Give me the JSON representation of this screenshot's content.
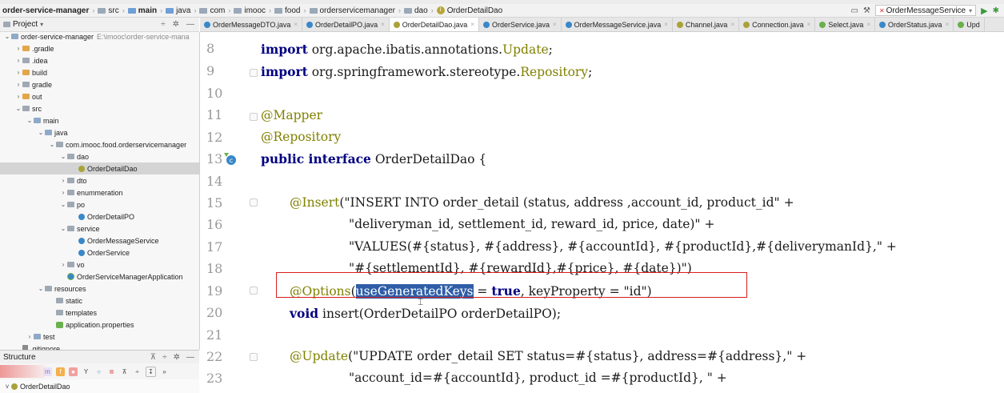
{
  "breadcrumb": [
    "order-service-manager",
    "src",
    "main",
    "java",
    "com",
    "imooc",
    "food",
    "orderservicemanager",
    "dao",
    "OrderDetailDao"
  ],
  "run_config": "OrderMessageService",
  "project_panel": {
    "title": "Project",
    "tree": [
      {
        "label": "order-service-manager",
        "hint": "E:\\imooc\\order-service-mana",
        "indent": 0,
        "arrow": "v",
        "icon": "module"
      },
      {
        "label": ".gradle",
        "indent": 1,
        "arrow": ">",
        "icon": "folder-orange"
      },
      {
        "label": ".idea",
        "indent": 1,
        "arrow": ">",
        "icon": "folder"
      },
      {
        "label": "build",
        "indent": 1,
        "arrow": ">",
        "icon": "folder-orange"
      },
      {
        "label": "gradle",
        "indent": 1,
        "arrow": ">",
        "icon": "folder"
      },
      {
        "label": "out",
        "indent": 1,
        "arrow": ">",
        "icon": "folder-orange"
      },
      {
        "label": "src",
        "indent": 1,
        "arrow": "v",
        "icon": "folder"
      },
      {
        "label": "main",
        "indent": 2,
        "arrow": "v",
        "icon": "folder-src"
      },
      {
        "label": "java",
        "indent": 3,
        "arrow": "v",
        "icon": "folder-src"
      },
      {
        "label": "com.imooc.food.orderservicemanager",
        "indent": 4,
        "arrow": "v",
        "icon": "folder"
      },
      {
        "label": "dao",
        "indent": 5,
        "arrow": "v",
        "icon": "folder"
      },
      {
        "label": "OrderDetailDao",
        "indent": 6,
        "arrow": "",
        "icon": "interface",
        "selected": true
      },
      {
        "label": "dto",
        "indent": 5,
        "arrow": ">",
        "icon": "folder"
      },
      {
        "label": "enummeration",
        "indent": 5,
        "arrow": ">",
        "icon": "folder"
      },
      {
        "label": "po",
        "indent": 5,
        "arrow": "v",
        "icon": "folder"
      },
      {
        "label": "OrderDetailPO",
        "indent": 6,
        "arrow": "",
        "icon": "class"
      },
      {
        "label": "service",
        "indent": 5,
        "arrow": "v",
        "icon": "folder"
      },
      {
        "label": "OrderMessageService",
        "indent": 6,
        "arrow": "",
        "icon": "class"
      },
      {
        "label": "OrderService",
        "indent": 6,
        "arrow": "",
        "icon": "class"
      },
      {
        "label": "vo",
        "indent": 5,
        "arrow": ">",
        "icon": "folder"
      },
      {
        "label": "OrderServiceManagerApplication",
        "indent": 5,
        "arrow": "",
        "icon": "app"
      },
      {
        "label": "resources",
        "indent": 3,
        "arrow": "v",
        "icon": "folder"
      },
      {
        "label": "static",
        "indent": 4,
        "arrow": "",
        "icon": "folder"
      },
      {
        "label": "templates",
        "indent": 4,
        "arrow": "",
        "icon": "folder"
      },
      {
        "label": "application.properties",
        "indent": 4,
        "arrow": "",
        "icon": "properties"
      },
      {
        "label": "test",
        "indent": 2,
        "arrow": ">",
        "icon": "folder-src"
      },
      {
        "label": ".gitignore",
        "indent": 1,
        "arrow": "",
        "icon": "file"
      }
    ]
  },
  "structure_panel": {
    "title": "Structure",
    "item": "OrderDetailDao"
  },
  "tabs": [
    {
      "label": "OrderMessageDTO.java",
      "icon": "class"
    },
    {
      "label": "OrderDetailPO.java",
      "icon": "class"
    },
    {
      "label": "OrderDetailDao.java",
      "icon": "interface",
      "active": true
    },
    {
      "label": "OrderService.java",
      "icon": "class"
    },
    {
      "label": "OrderMessageService.java",
      "icon": "class"
    },
    {
      "label": "Channel.java",
      "icon": "interface"
    },
    {
      "label": "Connection.java",
      "icon": "interface"
    },
    {
      "label": "Select.java",
      "icon": "annotation"
    },
    {
      "label": "OrderStatus.java",
      "icon": "class"
    },
    {
      "label": "Upd",
      "icon": "annotation"
    }
  ],
  "editor": {
    "line_numbers": [
      "8",
      "9",
      "10",
      "11",
      "12",
      "13",
      "14",
      "15",
      "16",
      "17",
      "18",
      "19",
      "20",
      "21",
      "22",
      "23"
    ],
    "lines": {
      "l8_kw": "import",
      "l8_rest": " org.apache.ibatis.annotations.",
      "l8_cls": "Update",
      "l8_end": ";",
      "l9_kw": "import",
      "l9_rest": " org.springframework.stereotype.",
      "l9_cls": "Repository",
      "l9_end": ";",
      "l11": "@Mapper",
      "l12": "@Repository",
      "l13_kw": "public interface",
      "l13_rest": " OrderDetailDao {",
      "l15_ann": "@Insert",
      "l15_rest": "(\"INSERT INTO order_detail (status, address ,account_id, product_id\" +",
      "l16": "\"deliveryman_id, settlement_id, reward_id, price, date)\" +",
      "l17": "\"VALUES(#{status}, #{address}, #{accountId}, #{productId},#{deliverymanId},\" +",
      "l18": "\"#{settlementId}, #{rewardId},#{price}, #{date})\")",
      "l19_ann": "@Options",
      "l19_open": "(",
      "l19_sel": "useGeneratedKeys",
      "l19_mid": " = ",
      "l19_kw": "true",
      "l19_rest": ", keyProperty = ",
      "l19_str": "\"id\"",
      "l19_end": ")",
      "l20_kw": "void",
      "l20_rest": " insert(OrderDetailPO orderDetailPO);",
      "l22_ann": "@Update",
      "l22_rest": "(\"UPDATE order_detail SET status=#{status}, address=#{address},\" +",
      "l23": "\"account_id=#{accountId}, product_id =#{productId}, \" +"
    }
  }
}
